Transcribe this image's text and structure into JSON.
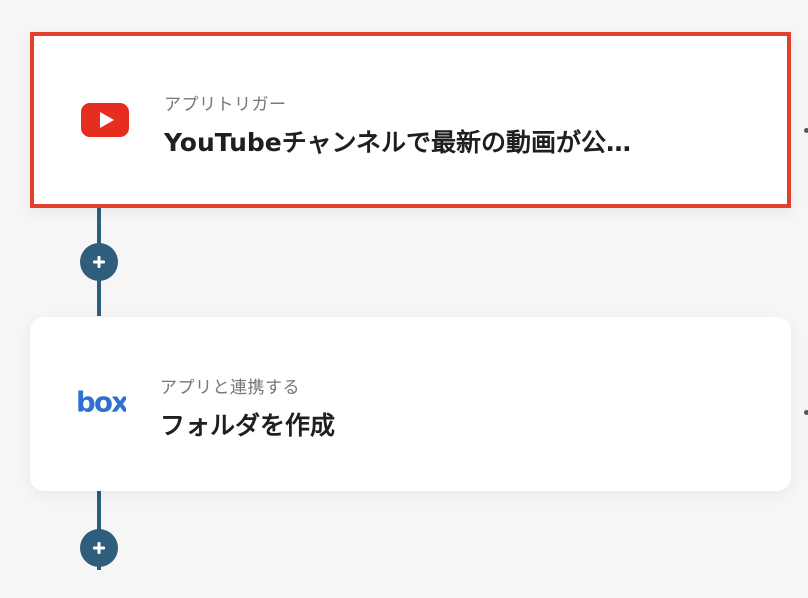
{
  "flow": {
    "steps": [
      {
        "label": "アプリトリガー",
        "title": "YouTubeチャンネルで最新の動画が公…",
        "icon": "youtube-icon",
        "selected": true
      },
      {
        "label": "アプリと連携する",
        "title": "フォルダを作成",
        "icon": "box-icon",
        "selected": false
      }
    ]
  },
  "colors": {
    "connector": "#2f5d7c",
    "selection_border": "#e1402a",
    "youtube_red": "#e62e20",
    "box_blue": "#2f6fcf"
  }
}
